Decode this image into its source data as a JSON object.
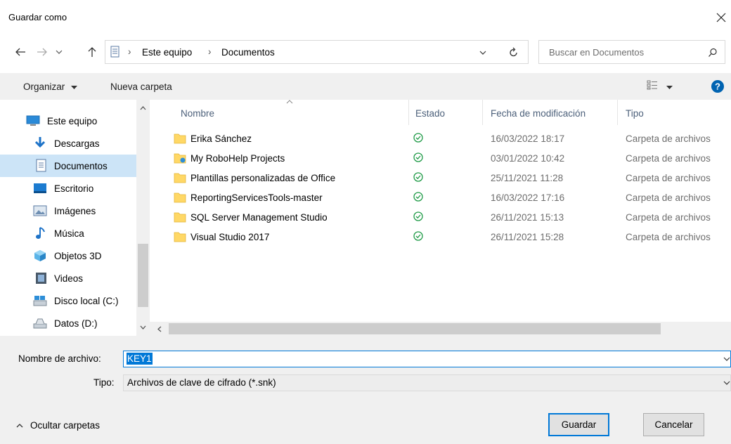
{
  "dialog": {
    "title": "Guardar como"
  },
  "address": {
    "breadcrumb_sep": "›",
    "crumbs": [
      "Este equipo",
      "Documentos"
    ]
  },
  "search": {
    "placeholder": "Buscar en Documentos"
  },
  "toolbar": {
    "organize_label": "Organizar",
    "new_folder_label": "Nueva carpeta"
  },
  "nav": {
    "items": [
      {
        "label": "Este equipo",
        "icon": "computer-icon",
        "selected": false
      },
      {
        "label": "Descargas",
        "icon": "downloads-icon",
        "selected": false
      },
      {
        "label": "Documentos",
        "icon": "documents-icon",
        "selected": true
      },
      {
        "label": "Escritorio",
        "icon": "desktop-icon",
        "selected": false
      },
      {
        "label": "Imágenes",
        "icon": "pictures-icon",
        "selected": false
      },
      {
        "label": "Música",
        "icon": "music-icon",
        "selected": false
      },
      {
        "label": "Objetos 3D",
        "icon": "objects3d-icon",
        "selected": false
      },
      {
        "label": "Videos",
        "icon": "videos-icon",
        "selected": false
      },
      {
        "label": "Disco local (C:)",
        "icon": "local-disk-icon",
        "selected": false
      },
      {
        "label": "Datos (D:)",
        "icon": "drive-icon",
        "selected": false
      }
    ]
  },
  "columns": {
    "name": "Nombre",
    "status": "Estado",
    "modified": "Fecha de modificación",
    "type": "Tipo"
  },
  "files": [
    {
      "name": "Erika Sánchez",
      "date": "16/03/2022 18:17",
      "type": "Carpeta de archivos"
    },
    {
      "name": "My RoboHelp Projects",
      "date": "03/01/2022 10:42",
      "type": "Carpeta de archivos"
    },
    {
      "name": "Plantillas personalizadas de Office",
      "date": "25/11/2021 11:28",
      "type": "Carpeta de archivos"
    },
    {
      "name": "ReportingServicesTools-master",
      "date": "16/03/2022 17:16",
      "type": "Carpeta de archivos"
    },
    {
      "name": "SQL Server Management Studio",
      "date": "26/11/2021 15:13",
      "type": "Carpeta de archivos"
    },
    {
      "name": "Visual Studio 2017",
      "date": "26/11/2021 15:28",
      "type": "Carpeta de archivos"
    }
  ],
  "form": {
    "filename_label": "Nombre de archivo:",
    "filename_value": "KEY1",
    "type_label": "Tipo:",
    "type_value": "Archivos de clave de cifrado (*.snk)"
  },
  "footer": {
    "hide_folders_label": "Ocultar carpetas",
    "save_label": "Guardar",
    "cancel_label": "Cancelar"
  },
  "colors": {
    "accent": "#0078d7",
    "selected_bg": "#cce4f7",
    "folder": "#ffd866",
    "status_ok": "#1e9a46"
  }
}
